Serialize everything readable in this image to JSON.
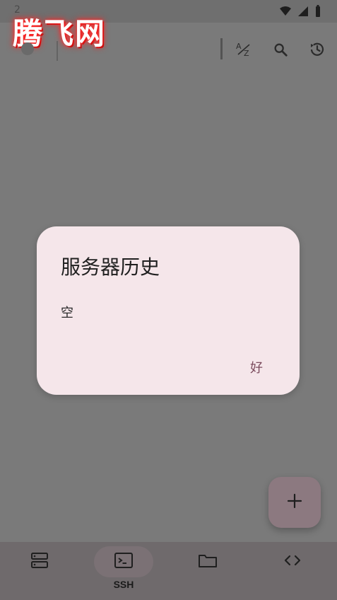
{
  "status_bar": {
    "time": "2"
  },
  "watermark": {
    "text": "腾飞网"
  },
  "toolbar": {
    "icons": [
      "sort-az-icon",
      "search-icon",
      "history-icon"
    ]
  },
  "dialog": {
    "title": "服务器历史",
    "body": "空",
    "ok_label": "好"
  },
  "fab": {
    "icon": "plus-icon"
  },
  "bottom_nav": {
    "items": [
      {
        "icon": "servers-icon",
        "label": ""
      },
      {
        "icon": "terminal-icon",
        "label": "SSH",
        "active": true
      },
      {
        "icon": "folder-icon",
        "label": ""
      },
      {
        "icon": "code-icon",
        "label": ""
      }
    ]
  },
  "colors": {
    "scrim": "#7a7a7a",
    "dialog_bg": "#f5e6ea",
    "accent_text": "#7b4b5d",
    "fab_bg": "#8c7980",
    "bottom_nav_bg": "#6f6a6c"
  }
}
